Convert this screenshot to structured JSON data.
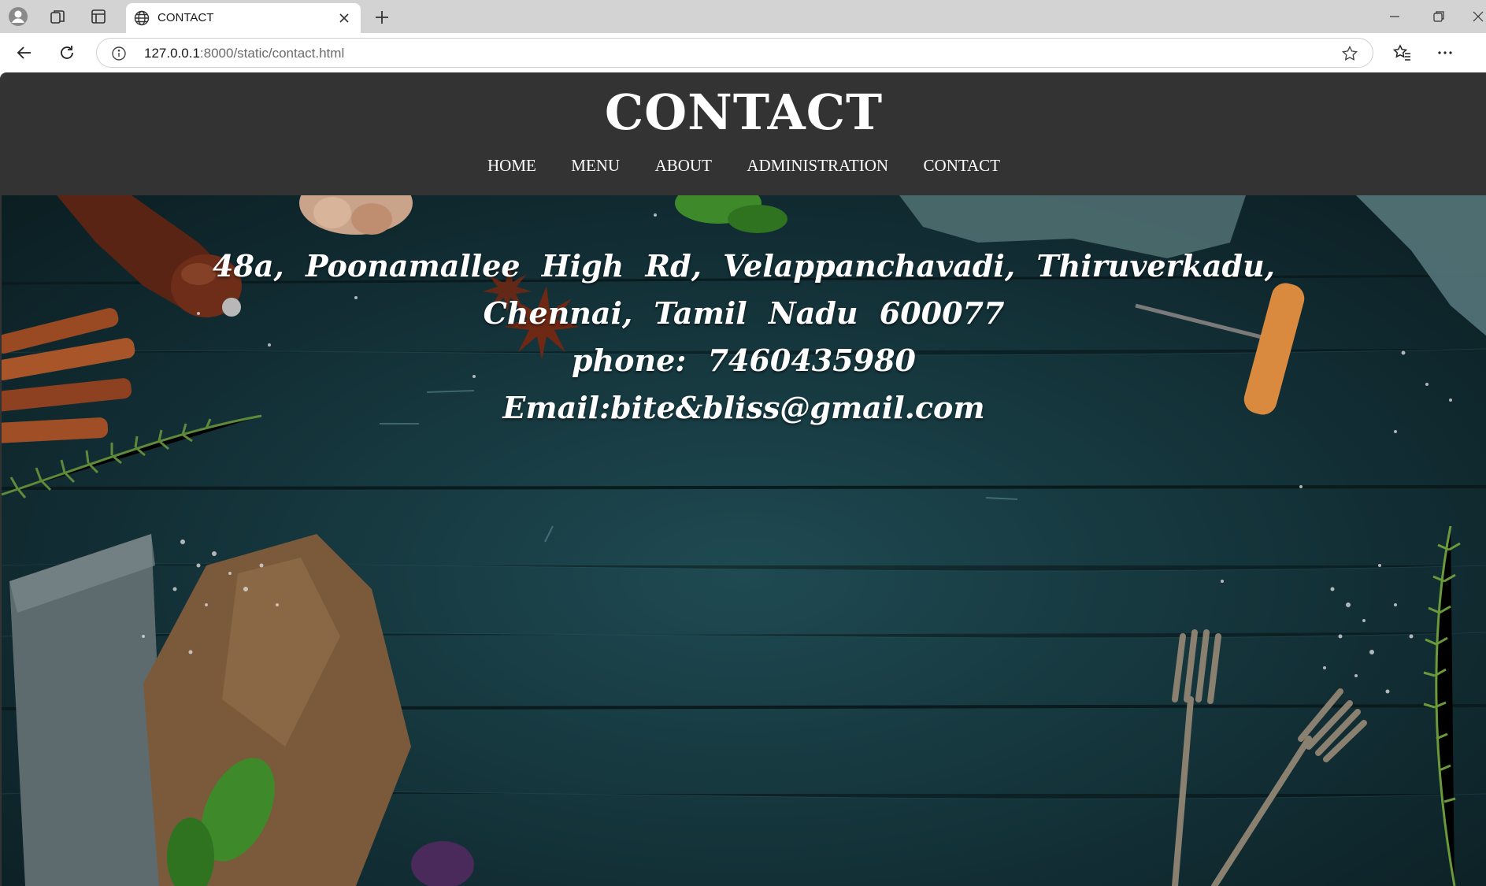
{
  "browser": {
    "tab_title": "CONTACT",
    "url_host": "127.0.0.1",
    "url_path": ":8000/static/contact.html",
    "icons": [
      "profile-icon",
      "collections-icon",
      "vertical-tabs-icon",
      "globe-icon",
      "close-icon",
      "new-tab-icon",
      "minimize-icon",
      "restore-icon",
      "window-close-icon",
      "back-icon",
      "refresh-icon",
      "info-icon",
      "favorite-star-icon",
      "favorites-icon",
      "more-icon"
    ]
  },
  "page": {
    "title": "CONTACT",
    "nav": [
      "HOME",
      "MENU",
      "ABOUT",
      "ADMINISTRATION",
      "CONTACT"
    ],
    "address_line1": "48a, Poonamallee High Rd, Velappanchavadi, Thiruverkadu,",
    "address_line2": "Chennai, Tamil Nadu 600077",
    "phone": "phone: 7460435980",
    "email": "Email:bite&bliss@gmail.com"
  },
  "colors": {
    "header_bg": "#333333",
    "hero_bg": "#173a41",
    "text": "#ffffff"
  }
}
